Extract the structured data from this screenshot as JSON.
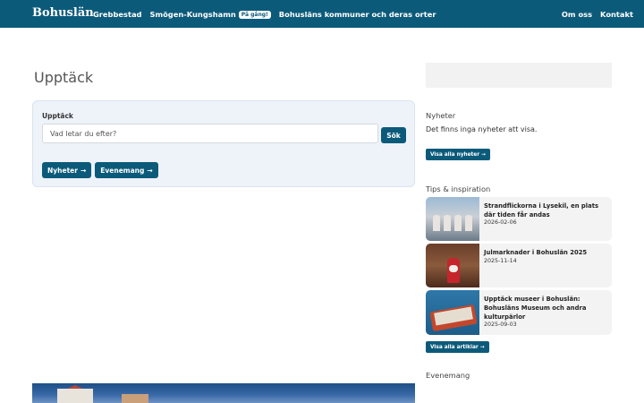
{
  "header": {
    "brand": "Bohuslän",
    "nav": [
      {
        "label": "Grebbestad"
      },
      {
        "label": "Smögen-Kungshamn",
        "badge": "På gång!"
      },
      {
        "label": "Bohusläns kommuner och deras orter"
      }
    ],
    "nav_right": [
      "Om oss",
      "Kontakt"
    ]
  },
  "main": {
    "title": "Upptäck",
    "search": {
      "label": "Upptäck",
      "placeholder": "Vad letar du efter?",
      "button": "Sök"
    },
    "chips": [
      {
        "label": "Nyheter",
        "icon": "arrow-right-icon"
      },
      {
        "label": "Evenemang",
        "icon": "arrow-right-icon"
      }
    ]
  },
  "sidebar": {
    "news": {
      "heading": "Nyheter",
      "empty_text": "Det finns inga nyheter att visa.",
      "button": "Visa alla nyheter"
    },
    "tips": {
      "heading": "Tips & inspiration",
      "items": [
        {
          "title": "Strandflickorna i Lysekil, en plats där tiden får andas",
          "date": "2026-02-06"
        },
        {
          "title": "Julmarknader i Bohuslän 2025",
          "date": "2025-11-14"
        },
        {
          "title": "Upptäck museer i Bohuslän: Bohusläns Museum och andra kulturpärlor",
          "date": "2025-09-03"
        }
      ],
      "button": "Visa alla artiklar"
    },
    "events": {
      "heading": "Evenemang"
    }
  },
  "arrow": "→",
  "colors": {
    "brand": "#0c5a7a",
    "card_bg": "#eef3fa",
    "tip_bg": "#f3f3f3"
  }
}
